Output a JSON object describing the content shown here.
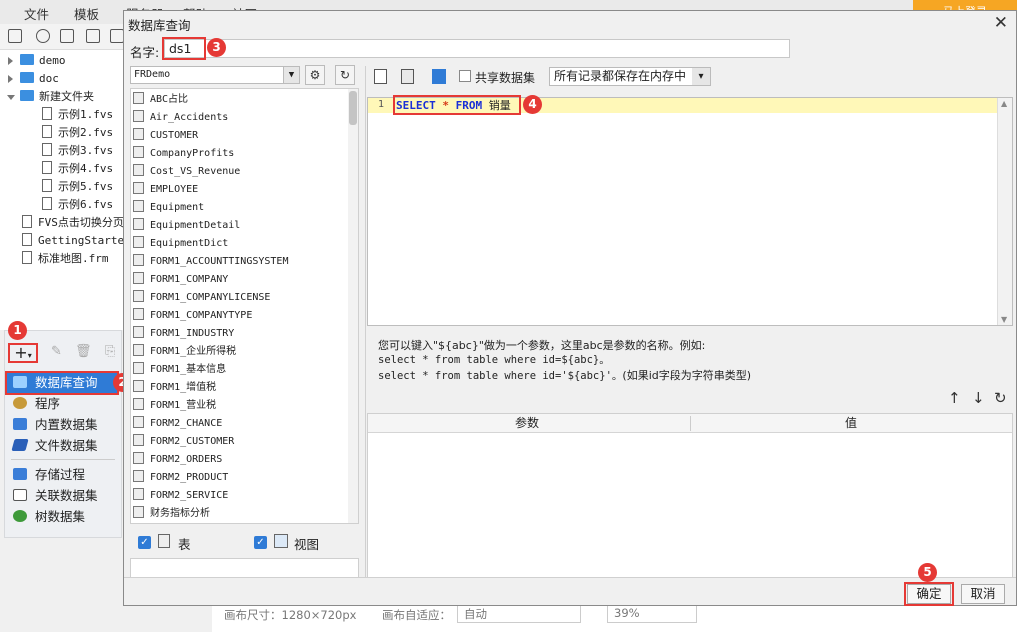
{
  "app": {
    "menu": [
      "文件",
      "模板",
      "服务器",
      "帮助",
      "社区"
    ],
    "login_label": "马上登录"
  },
  "file_tree": {
    "items": [
      {
        "label": "demo",
        "type": "folder",
        "state": "collapsed"
      },
      {
        "label": "doc",
        "type": "folder",
        "state": "collapsed"
      },
      {
        "label": "新建文件夹",
        "type": "folder",
        "state": "expanded"
      },
      {
        "label": "示例1.fvs",
        "type": "file"
      },
      {
        "label": "示例2.fvs",
        "type": "file"
      },
      {
        "label": "示例3.fvs",
        "type": "file"
      },
      {
        "label": "示例4.fvs",
        "type": "file"
      },
      {
        "label": "示例5.fvs",
        "type": "file"
      },
      {
        "label": "示例6.fvs",
        "type": "file"
      },
      {
        "label": "FVS点击切换分页",
        "type": "file"
      },
      {
        "label": "GettingStarted",
        "type": "file"
      },
      {
        "label": "标准地图.frm",
        "type": "file"
      }
    ]
  },
  "dataset_menu": {
    "items": [
      {
        "label": "数据库查询",
        "color": "#2f7bd6"
      },
      {
        "label": "程序",
        "color": "#c79a3a"
      },
      {
        "label": "内置数据集",
        "color": "#3b7ed8"
      },
      {
        "label": "文件数据集",
        "color": "#2a5fb8"
      },
      {
        "label": "存储过程",
        "color": "#3b7ed8"
      },
      {
        "label": "关联数据集",
        "color": "#555555"
      },
      {
        "label": "树数据集",
        "color": "#3e9a3a"
      }
    ]
  },
  "status_bar": {
    "canvas_size": "画布尺寸：1280×720px",
    "adaptive_label": "画布自适应：",
    "adaptive_value": "自动",
    "zoom": "39%"
  },
  "dialog": {
    "title": "数据库查询",
    "name_label": "名字:",
    "name_value": "ds1",
    "connection": "FRDemo",
    "tables": [
      "ABC占比",
      "Air_Accidents",
      "CUSTOMER",
      "CompanyProfits",
      "Cost_VS_Revenue",
      "EMPLOYEE",
      "Equipment",
      "EquipmentDetail",
      "EquipmentDict",
      "FORM1_ACCOUNTTINGSYSTEM",
      "FORM1_COMPANY",
      "FORM1_COMPANYLICENSE",
      "FORM1_COMPANYTYPE",
      "FORM1_INDUSTRY",
      "FORM1_企业所得税",
      "FORM1_基本信息",
      "FORM1_增值税",
      "FORM1_营业税",
      "FORM2_CHANCE",
      "FORM2_CUSTOMER",
      "FORM2_ORDERS",
      "FORM2_PRODUCT",
      "FORM2_SERVICE",
      "财务指标分析"
    ],
    "filter_table": "表",
    "filter_view": "视图",
    "share_label": "共享数据集",
    "cache_option": "所有记录都保存在内存中",
    "sql": {
      "line_number": "1",
      "kw1": "SELECT",
      "op": "*",
      "kw2": "FROM",
      "table": "销量"
    },
    "hint": {
      "line1": "您可以键入\"${abc}\"做为一个参数，这里abc是参数的名称。例如:",
      "line2": "select * from table where id=${abc}。",
      "line3a": "select * from table where id='${abc}'。",
      "line3b": "(如果id字段为字符串类型)"
    },
    "param_columns": [
      "参数",
      "值"
    ],
    "ok_label": "确定",
    "cancel_label": "取消"
  },
  "annotations": [
    "1",
    "2",
    "3",
    "4",
    "5"
  ]
}
